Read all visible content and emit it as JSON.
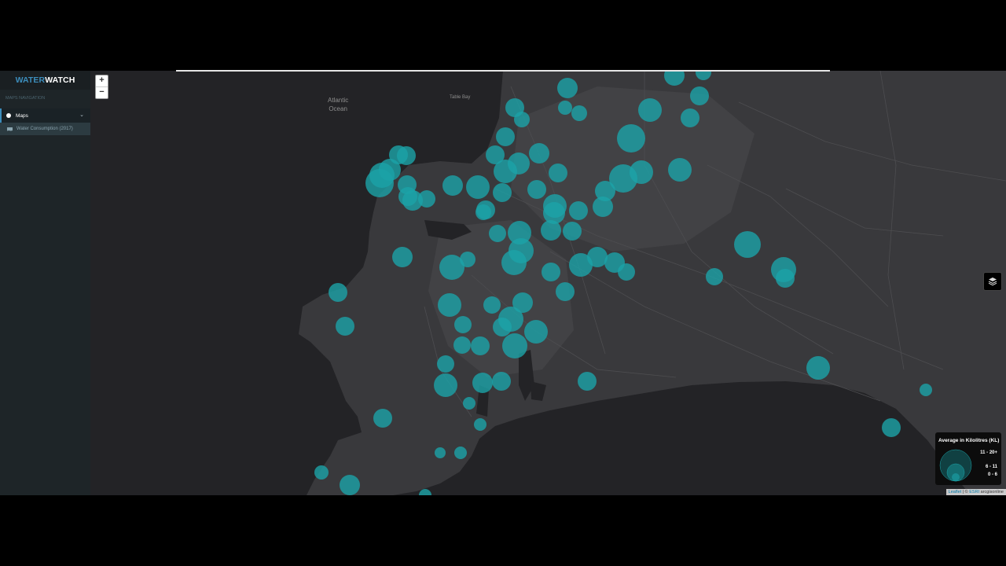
{
  "app": {
    "brand_part1": "WATER",
    "brand_part2": "WATCH"
  },
  "sidebar": {
    "section_header": "MAPS NAVIGATION",
    "menu": {
      "label": "Maps",
      "icon": "globe-icon",
      "expand_icon": "chevron-down-icon"
    },
    "sub_items": [
      {
        "label": "Water Consumption (2017)",
        "icon": "map-icon"
      }
    ]
  },
  "map": {
    "zoom_in": "+",
    "zoom_out": "−",
    "labels": {
      "ocean_line1": "Atlantic",
      "ocean_line2": "Ocean",
      "bay": "Table Bay"
    },
    "layers_icon": "layers-icon",
    "marker_color": "#1ba3a8",
    "legend": {
      "title": "Average in Kilolitres (KL)",
      "classes": [
        "11 - 20+",
        "6 - 11",
        "0 - 6"
      ]
    },
    "attribution": {
      "leaflet": "Leaflet",
      "separator": " | © ",
      "esri": "ESRI",
      "rest": " arcgisonline"
    }
  }
}
